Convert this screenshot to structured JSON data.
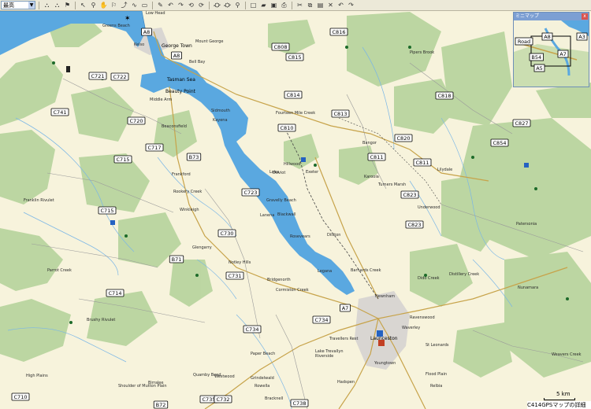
{
  "toolbar": {
    "zoom_select": "最高",
    "dropdown_arrow": "▼"
  },
  "minimap": {
    "title": "ミニマップ",
    "close_glyph": "x",
    "labels": [
      "A8",
      "A3",
      "Road",
      "A7",
      "B54",
      "A5"
    ]
  },
  "scale": {
    "text": "5 km"
  },
  "status": {
    "text": "C414GPSマップの詳細"
  },
  "places": [
    "Low Head",
    "Greens Beach",
    "Kelso",
    "George Town",
    "Mount George",
    "Bell Bay",
    "Tasman Sea",
    "Beauty Point",
    "Middle Arm",
    "Beaconsfield",
    "Hillwood",
    "Fourteen Mile Creek",
    "Lilydale",
    "Pipers Brook",
    "Gravelly Beach",
    "Loira",
    "Lanena",
    "Blackwall",
    "Rosevears",
    "Legana",
    "Dilston",
    "Bangor",
    "Karoola",
    "Turners Marsh",
    "Underwood",
    "Franklin Rivulet",
    "Rookery Creek",
    "Parrot Creek",
    "Brushy Rivulet",
    "Cormiston Creek",
    "Barnards Creek",
    "Dido Creek",
    "Distillery Creek",
    "Launceston",
    "Newnham",
    "Ravenswood",
    "Waverley",
    "St Leonards",
    "Flood Plain",
    "Relbia",
    "Youngtown",
    "Travellers Rest",
    "Lake Trevallyn",
    "Grindelwald",
    "Exeter",
    "Winkleigh",
    "Kayena",
    "Rowella",
    "Deviot",
    "Glengarry",
    "Notley Hills",
    "Bridgenorth",
    "Riverside",
    "Hadspen",
    "Bracknell",
    "Sidmouth",
    "Paper Beach",
    "Frankford",
    "Birralee",
    "Westwood",
    "Quamby Bend",
    "Shoulder of Mutton Plain",
    "High Plains",
    "Patersonia",
    "Nunamara",
    "Weavers Creek"
  ],
  "roads": [
    "C816",
    "C808",
    "C815",
    "A8",
    "A8",
    "C721",
    "C722",
    "C741",
    "C720",
    "C717",
    "C715",
    "B73",
    "C814",
    "C813",
    "C810",
    "C820",
    "C811",
    "C811",
    "C823",
    "C823",
    "C818",
    "C827",
    "C854",
    "C723",
    "C715",
    "C730",
    "B71",
    "C731",
    "C714",
    "A7",
    "C734",
    "C734",
    "C710",
    "B72",
    "C735",
    "C732",
    "C738"
  ]
}
